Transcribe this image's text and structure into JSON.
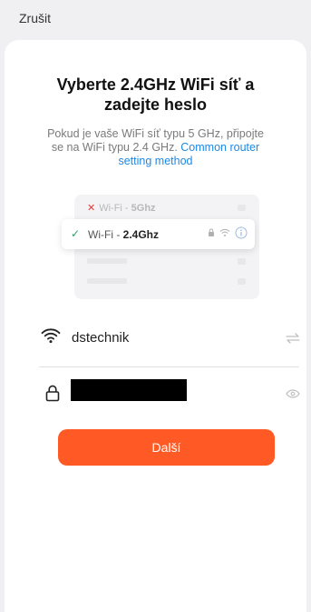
{
  "header": {
    "cancel_label": "Zrušit"
  },
  "title": "Vyberte 2.4GHz WiFi síť a zadejte heslo",
  "subtitle": {
    "text": "Pokud je vaše WiFi síť typu 5 GHz, připojte se na WiFi typu 2.4 GHz.",
    "link": "Common router setting method"
  },
  "illustration": {
    "bad_network": {
      "prefix": "Wi-Fi - ",
      "band": "5Ghz"
    },
    "good_network": {
      "prefix": "Wi-Fi - ",
      "band": "2.4Ghz"
    }
  },
  "form": {
    "ssid": "dstechnik",
    "password_masked": true
  },
  "next_button_label": "Další",
  "colors": {
    "accent": "#ff5a26",
    "link": "#1e88e5",
    "ok": "#2e9e6a",
    "error": "#e53935"
  },
  "icons": {
    "wifi": "wifi-icon",
    "lock": "lock-icon",
    "switch": "switch-network-icon",
    "eye": "eye-icon",
    "info": "info-icon"
  }
}
